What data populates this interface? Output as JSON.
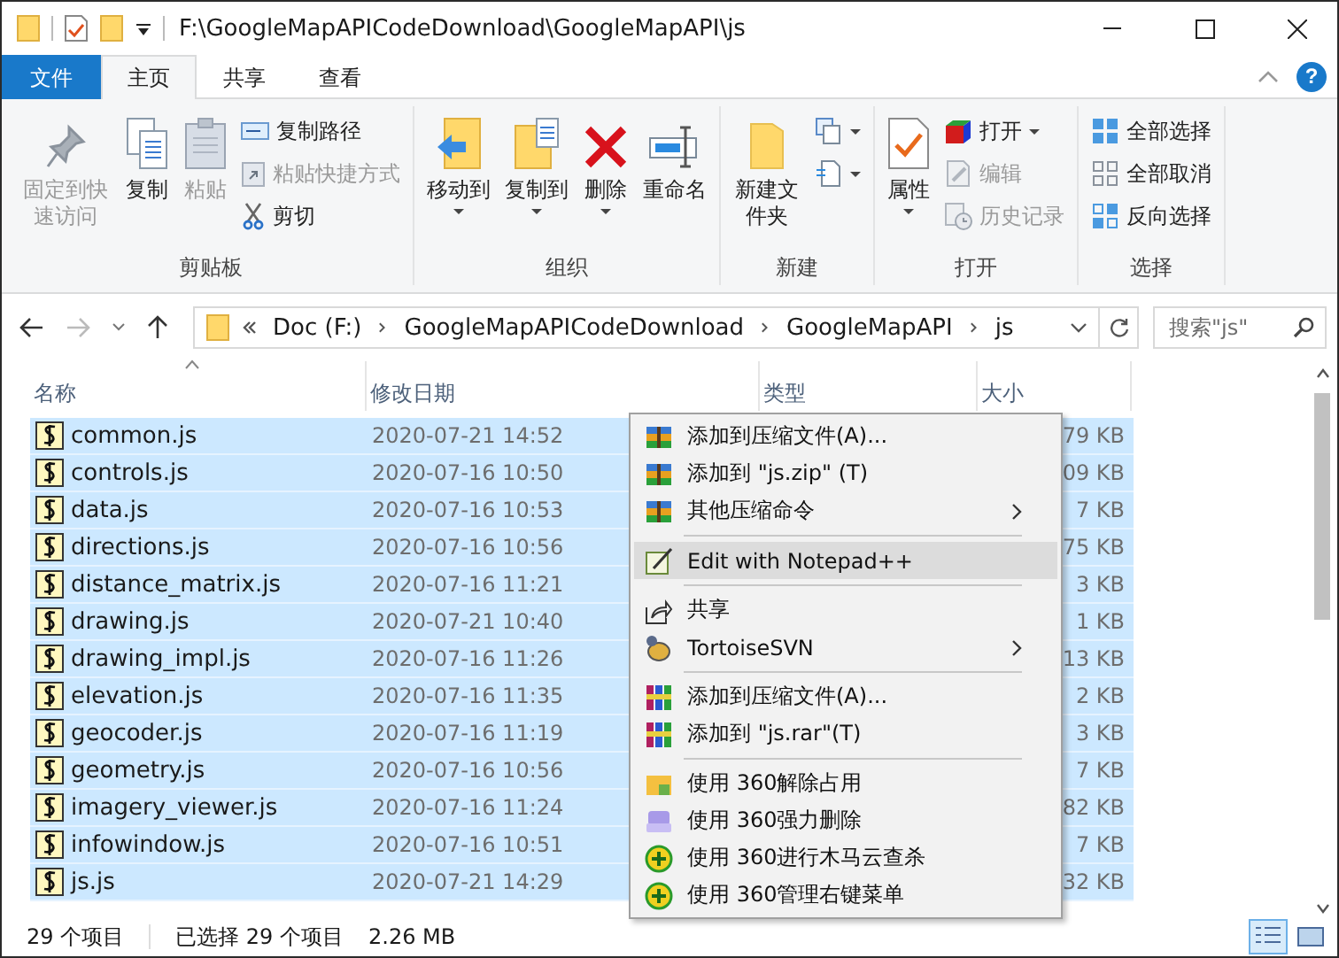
{
  "title_bar": {
    "path": "F:\\GoogleMapAPICodeDownload\\GoogleMapAPI\\js"
  },
  "ribbon_tabs": [
    {
      "label": "文件",
      "kind": "file",
      "selected": false
    },
    {
      "label": "主页",
      "kind": "tab",
      "selected": true
    },
    {
      "label": "共享",
      "kind": "tab",
      "selected": false
    },
    {
      "label": "查看",
      "kind": "tab",
      "selected": false
    }
  ],
  "help": "?",
  "ribbon_groups": [
    {
      "label": "剪贴板",
      "items": [
        {
          "label": "固定到快速访问",
          "kind": "large",
          "disabled": true,
          "dropdown": false
        },
        {
          "label": "复制",
          "kind": "large",
          "disabled": false,
          "dropdown": false
        },
        {
          "label": "粘贴",
          "kind": "large",
          "disabled": true,
          "dropdown": false
        },
        {
          "label": "复制路径",
          "kind": "small",
          "disabled": false,
          "dropdown": false
        },
        {
          "label": "粘贴快捷方式",
          "kind": "small",
          "disabled": true,
          "dropdown": false
        },
        {
          "label": "剪切",
          "kind": "small",
          "disabled": false,
          "dropdown": false
        }
      ]
    },
    {
      "label": "组织",
      "items": [
        {
          "label": "移动到",
          "kind": "large",
          "disabled": false,
          "dropdown": true
        },
        {
          "label": "复制到",
          "kind": "large",
          "disabled": false,
          "dropdown": true
        },
        {
          "label": "删除",
          "kind": "large",
          "disabled": false,
          "dropdown": true
        },
        {
          "label": "重命名",
          "kind": "large",
          "disabled": false,
          "dropdown": false
        }
      ]
    },
    {
      "label": "新建",
      "items": [
        {
          "label": "新建文件夹",
          "kind": "large",
          "disabled": false,
          "dropdown": false
        },
        {
          "kind": "small",
          "disabled": false,
          "dropdown": true
        },
        {
          "kind": "small",
          "disabled": false,
          "dropdown": true
        }
      ]
    },
    {
      "label": "打开",
      "items": [
        {
          "label": "属性",
          "kind": "large",
          "disabled": false,
          "dropdown": true
        },
        {
          "label": "打开",
          "kind": "small",
          "disabled": false,
          "dropdown": true
        },
        {
          "label": "编辑",
          "kind": "small",
          "disabled": true,
          "dropdown": false
        },
        {
          "label": "历史记录",
          "kind": "small",
          "disabled": true,
          "dropdown": false
        }
      ]
    },
    {
      "label": "选择",
      "items": [
        {
          "label": "全部选择",
          "kind": "small",
          "disabled": false,
          "dropdown": false
        },
        {
          "label": "全部取消",
          "kind": "small",
          "disabled": false,
          "dropdown": false
        },
        {
          "label": "反向选择",
          "kind": "small",
          "disabled": false,
          "dropdown": false
        }
      ]
    }
  ],
  "address_bar": {
    "breadcrumbs": [
      "Doc (F:)",
      "GoogleMapAPICodeDownload",
      "GoogleMapAPI",
      "js"
    ]
  },
  "search": {
    "placeholder": "搜索\"js\""
  },
  "columns": [
    {
      "label": "名称",
      "sorted": true
    },
    {
      "label": "修改日期",
      "sorted": false
    },
    {
      "label": "类型",
      "sorted": false
    },
    {
      "label": "大小",
      "sorted": false
    }
  ],
  "files": [
    {
      "name": "common.js",
      "modified": "2020-07-21 14:52",
      "size": "79 KB",
      "selected": true
    },
    {
      "name": "controls.js",
      "modified": "2020-07-16 10:50",
      "size": "09 KB",
      "selected": true
    },
    {
      "name": "data.js",
      "modified": "2020-07-16 10:53",
      "size": "7 KB",
      "selected": true
    },
    {
      "name": "directions.js",
      "modified": "2020-07-16 10:56",
      "size": "75 KB",
      "selected": true
    },
    {
      "name": "distance_matrix.js",
      "modified": "2020-07-16 11:21",
      "size": "3 KB",
      "selected": true
    },
    {
      "name": "drawing.js",
      "modified": "2020-07-21 10:40",
      "size": "1 KB",
      "selected": true
    },
    {
      "name": "drawing_impl.js",
      "modified": "2020-07-16 11:26",
      "size": "13 KB",
      "selected": true
    },
    {
      "name": "elevation.js",
      "modified": "2020-07-16 11:35",
      "size": "2 KB",
      "selected": true
    },
    {
      "name": "geocoder.js",
      "modified": "2020-07-16 11:19",
      "size": "3 KB",
      "selected": true
    },
    {
      "name": "geometry.js",
      "modified": "2020-07-16 10:56",
      "size": "7 KB",
      "selected": true
    },
    {
      "name": "imagery_viewer.js",
      "modified": "2020-07-16 11:24",
      "size": "82 KB",
      "selected": true
    },
    {
      "name": "infowindow.js",
      "modified": "2020-07-16 10:51",
      "size": "7 KB",
      "selected": true
    },
    {
      "name": "js.js",
      "modified": "2020-07-21 14:29",
      "size": "32 KB",
      "selected": true
    }
  ],
  "context_menu": [
    {
      "kind": "item",
      "label": "添加到压缩文件(A)...",
      "submenu": false,
      "highlighted": false
    },
    {
      "kind": "item",
      "label": "添加到 \"js.zip\" (T)",
      "submenu": false,
      "highlighted": false
    },
    {
      "kind": "item",
      "label": "其他压缩命令",
      "submenu": true,
      "highlighted": false
    },
    {
      "kind": "separator"
    },
    {
      "kind": "item",
      "label": "Edit with Notepad++",
      "submenu": false,
      "highlighted": true
    },
    {
      "kind": "separator"
    },
    {
      "kind": "item",
      "label": "共享",
      "submenu": false,
      "highlighted": false
    },
    {
      "kind": "item",
      "label": "TortoiseSVN",
      "submenu": true,
      "highlighted": false
    },
    {
      "kind": "separator"
    },
    {
      "kind": "item",
      "label": "添加到压缩文件(A)...",
      "submenu": false,
      "highlighted": false
    },
    {
      "kind": "item",
      "label": "添加到 \"js.rar\"(T)",
      "submenu": false,
      "highlighted": false
    },
    {
      "kind": "separator"
    },
    {
      "kind": "item",
      "label": "使用 360解除占用",
      "submenu": false,
      "highlighted": false
    },
    {
      "kind": "item",
      "label": "使用 360强力删除",
      "submenu": false,
      "highlighted": false
    },
    {
      "kind": "item",
      "label": "使用 360进行木马云查杀",
      "submenu": false,
      "highlighted": false
    },
    {
      "kind": "item",
      "label": "使用 360管理右键菜单",
      "submenu": false,
      "highlighted": false
    }
  ],
  "status_bar": {
    "item_count": "29 个项目",
    "selection": "已选择 29 个项目",
    "selection_size": "2.26 MB"
  }
}
